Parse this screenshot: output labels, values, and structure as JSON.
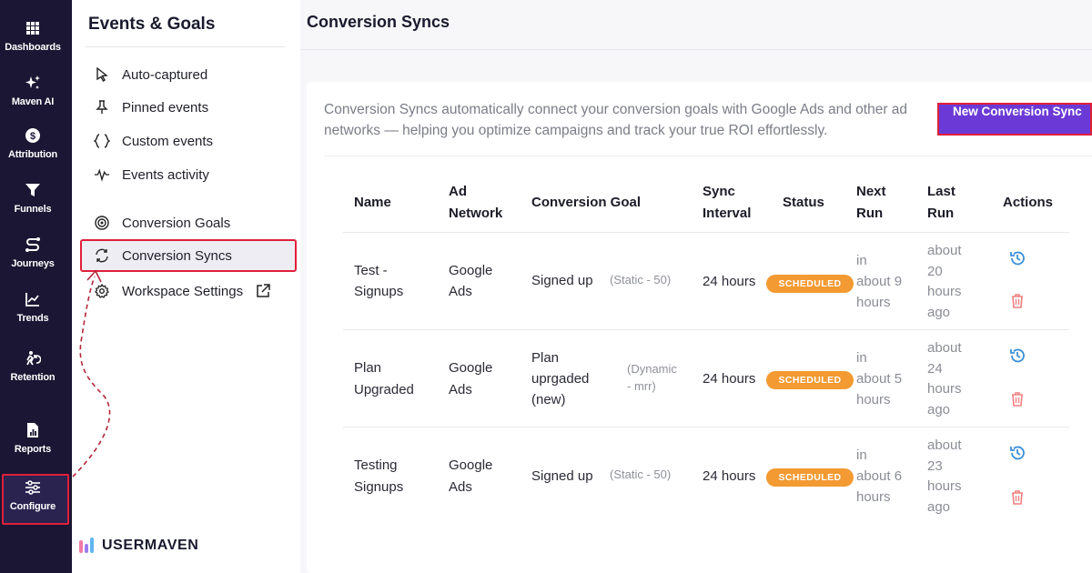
{
  "rail": {
    "items": [
      {
        "label": "Dashboards",
        "icon": "grid-icon"
      },
      {
        "label": "Maven AI",
        "icon": "sparkle-icon"
      },
      {
        "label": "Attribution",
        "icon": "dollar-icon"
      },
      {
        "label": "Funnels",
        "icon": "funnel-icon"
      },
      {
        "label": "Journeys",
        "icon": "route-icon"
      },
      {
        "label": "Trends",
        "icon": "line-chart-icon"
      },
      {
        "label": "Retention",
        "icon": "runner-icon"
      },
      {
        "label": "Reports",
        "icon": "report-icon"
      },
      {
        "label": "Configure",
        "icon": "sliders-icon"
      }
    ]
  },
  "nav": {
    "title": "Events & Goals",
    "items": [
      {
        "label": "Auto-captured",
        "icon": "cursor-icon"
      },
      {
        "label": "Pinned events",
        "icon": "pin-icon"
      },
      {
        "label": "Custom events",
        "icon": "braces-icon"
      },
      {
        "label": "Events activity",
        "icon": "pulse-icon"
      },
      {
        "label": "Conversion Goals",
        "icon": "target-icon"
      },
      {
        "label": "Conversion Syncs",
        "icon": "sync-icon"
      },
      {
        "label": "Workspace Settings",
        "icon": "gear-icon"
      }
    ]
  },
  "main": {
    "title": "Conversion Syncs",
    "intro": "Conversion Syncs automatically connect your conversion goals with Google Ads and other ad networks — helping you optimize campaigns and track your true ROI effortlessly.",
    "new_button": "New Conversion Sync"
  },
  "table": {
    "headers": {
      "name": "Name",
      "ad_network_1": "Ad",
      "ad_network_2": "Network",
      "goal": "Conversion Goal",
      "interval_1": "Sync",
      "interval_2": "Interval",
      "status": "Status",
      "next_1": "Next",
      "next_2": "Run",
      "last_1": "Last",
      "last_2": "Run",
      "actions": "Actions"
    },
    "rows": [
      {
        "name_1": "Test -",
        "name_2": "Signups",
        "network_1": "Google",
        "network_2": "Ads",
        "goal_1": "Signed up",
        "goal_2": "",
        "goal_3": "",
        "goal_type_1": "(Static - 50)",
        "goal_type_2": "",
        "interval": "24 hours",
        "status": "SCHEDULED",
        "next_1": "in",
        "next_2": "about 9",
        "next_3": "hours",
        "last_1": "about",
        "last_2": "20",
        "last_3": "hours",
        "last_4": "ago"
      },
      {
        "name_1": "Plan",
        "name_2": "Upgraded",
        "network_1": "Google",
        "network_2": "Ads",
        "goal_1": "Plan",
        "goal_2": "uprgaded",
        "goal_3": "(new)",
        "goal_type_1": "(Dynamic",
        "goal_type_2": "- mrr)",
        "interval": "24 hours",
        "status": "SCHEDULED",
        "next_1": "in",
        "next_2": "about 5",
        "next_3": "hours",
        "last_1": "about",
        "last_2": "24",
        "last_3": "hours",
        "last_4": "ago"
      },
      {
        "name_1": "Testing",
        "name_2": "Signups",
        "network_1": "Google",
        "network_2": "Ads",
        "goal_1": "Signed up",
        "goal_2": "",
        "goal_3": "",
        "goal_type_1": "(Static - 50)",
        "goal_type_2": "",
        "interval": "24 hours",
        "status": "SCHEDULED",
        "next_1": "in",
        "next_2": "about 6",
        "next_3": "hours",
        "last_1": "about",
        "last_2": "23",
        "last_3": "hours",
        "last_4": "ago"
      }
    ]
  },
  "logo": {
    "text": "USERMAVEN"
  },
  "colors": {
    "rail_bg": "#1b1633",
    "highlight_border": "#e0203a",
    "primary_button": "#6b3ad6",
    "status_badge": "#f39a32",
    "history_icon": "#3b8fd9",
    "delete_icon": "#f08080"
  }
}
